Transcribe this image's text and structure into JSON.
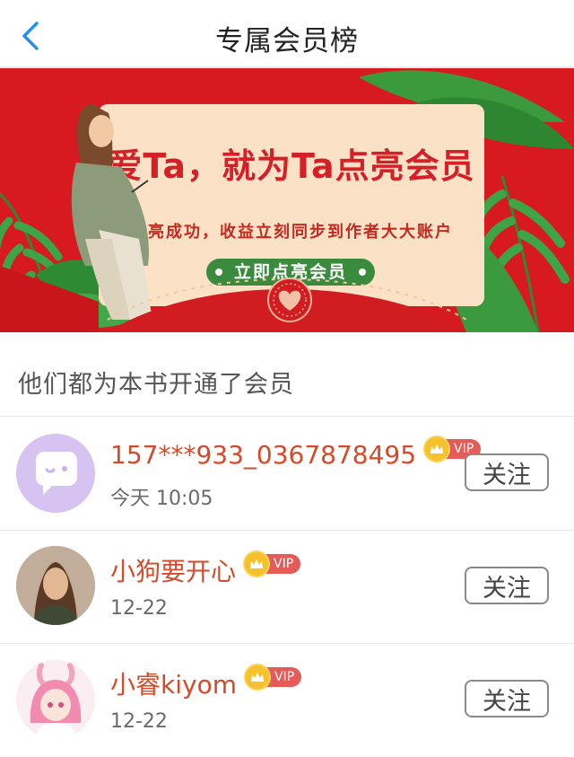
{
  "header": {
    "title": "专属会员榜"
  },
  "banner": {
    "headline": "爱Ta，就为Ta点亮会员",
    "subline": "点亮成功，收益立刻同步到作者大大账户",
    "cta": "立即点亮会员"
  },
  "section": {
    "title": "他们都为本书开通了会员"
  },
  "members": [
    {
      "name": "157***933_0367878495",
      "badge": "VIP",
      "date": "今天 10:05",
      "follow": "关注"
    },
    {
      "name": "小狗要开心",
      "badge": "VIP",
      "date": "12-22",
      "follow": "关注"
    },
    {
      "name": "小睿kiyom",
      "badge": "VIP",
      "date": "12-22",
      "follow": "关注"
    }
  ],
  "colors": {
    "accent": "#2a8fe8",
    "banner_red": "#d71a1f",
    "name_red": "#d54a2a",
    "vip_red": "#e45b57",
    "cta_green": "#3b8b3f"
  }
}
